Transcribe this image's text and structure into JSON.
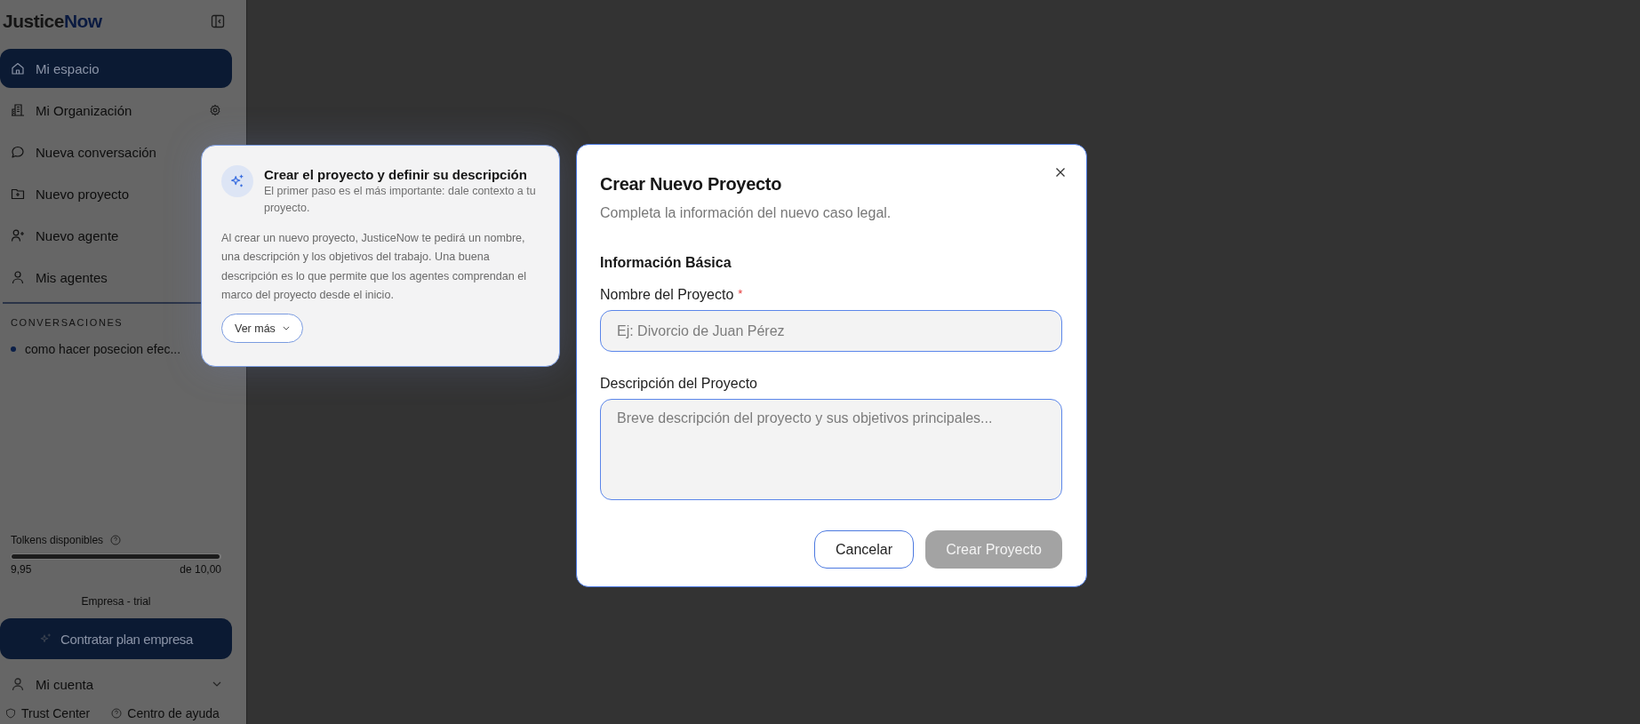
{
  "brand": {
    "primary": "Justice",
    "accent": "Now"
  },
  "sidebar": {
    "items": [
      {
        "label": "Mi espacio",
        "kind": "home",
        "selected": true,
        "has_settings": false
      },
      {
        "label": "Mi Organización",
        "kind": "building",
        "selected": false,
        "has_settings": true
      },
      {
        "label": "Nueva conversación",
        "kind": "chat",
        "selected": false,
        "has_settings": false
      },
      {
        "label": "Nuevo proyecto",
        "kind": "folder",
        "selected": false,
        "has_settings": false
      },
      {
        "label": "Nuevo agente",
        "kind": "user-plus",
        "selected": false,
        "has_settings": false
      },
      {
        "label": "Mis agentes",
        "kind": "user",
        "selected": false,
        "has_settings": false
      }
    ],
    "conversations_heading": "CONVERSACIONES",
    "conversations": [
      {
        "title": "como hacer posecion efec..."
      }
    ],
    "tokens": {
      "label": "Tolkens disponibles",
      "level": 0.995,
      "used": "9,95",
      "total": "de 10,00"
    },
    "plan": "Empresa - trial",
    "upgrade_button": "Contratar plan empresa",
    "account": "Mi cuenta",
    "footer_links": [
      "Trust Center",
      "Centro de ayuda"
    ]
  },
  "guide_card": {
    "title": "Crear el proyecto y definir su descripción",
    "subtitle": "El primer paso es el más importante: dale contexto a tu proyecto.",
    "body": "Al crear un nuevo proyecto, JusticeNow te pedirá un nombre, una descripción y los objetivos del trabajo. Una buena descripción es lo que permite que los agentes comprendan el marco del proyecto desde el inicio.",
    "button": "Ver más"
  },
  "dialog": {
    "title": "Crear Nuevo Proyecto",
    "subtitle": "Completa la información del nuevo caso legal.",
    "section": "Información Básica",
    "fields": [
      {
        "label": "Nombre del Proyecto",
        "required_mark": "*",
        "kind": "input",
        "placeholder": "Ej: Divorcio de Juan Pérez"
      },
      {
        "label": "Descripción del Proyecto",
        "kind": "textarea",
        "placeholder": "Breve descripción del proyecto y sus objetivos principales..."
      }
    ],
    "buttons": [
      {
        "label": "Cancelar",
        "disabled": false
      },
      {
        "label": "Crear Proyecto",
        "disabled": true
      }
    ]
  }
}
